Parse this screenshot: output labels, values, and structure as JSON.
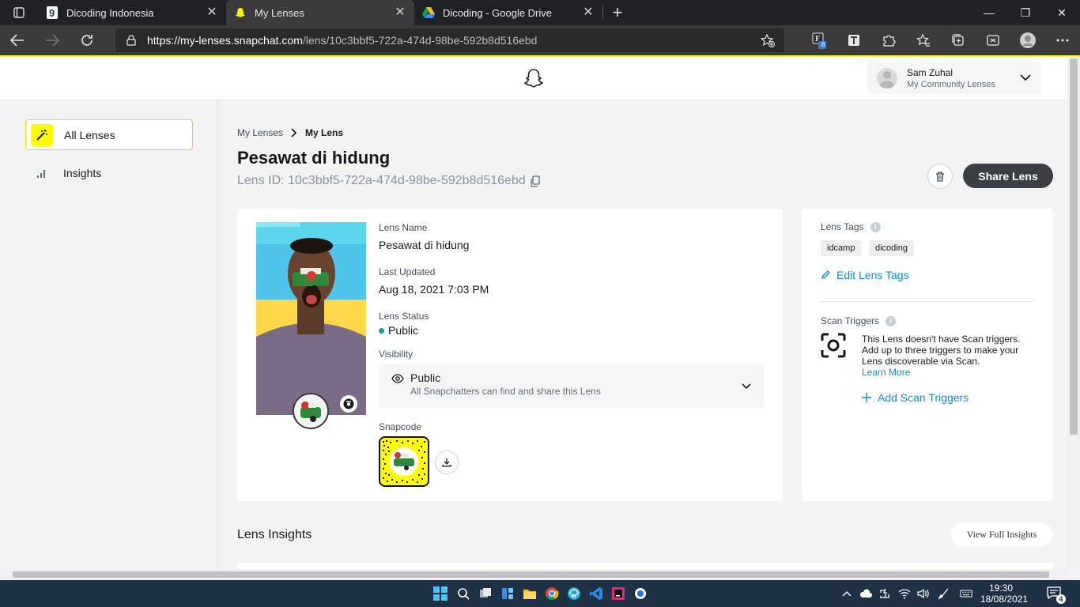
{
  "browser": {
    "tabs": [
      {
        "title": "Dicoding Indonesia",
        "favicon": "dicoding-icon",
        "active": false
      },
      {
        "title": "My Lenses",
        "favicon": "snapchat-icon",
        "active": true
      },
      {
        "title": "Dicoding - Google Drive",
        "favicon": "google-drive-icon",
        "active": false
      }
    ],
    "url_host": "https://my-lenses.snapchat.com",
    "url_path": "/lens/10c3bbf5-722a-474d-98be-592b8d516ebd",
    "extension_badge": "8"
  },
  "header": {
    "logo": "snapchat-ghost-icon",
    "user_name": "Sam Zuhal",
    "user_sub": "My Community Lenses"
  },
  "sidebar": {
    "items": [
      {
        "label": "All Lenses",
        "icon": "magic-wand-icon",
        "active": true
      },
      {
        "label": "Insights",
        "icon": "bar-chart-icon",
        "active": false
      }
    ]
  },
  "breadcrumb": {
    "parent": "My Lenses",
    "current": "My Lens"
  },
  "lens": {
    "title": "Pesawat di hidung",
    "id_text": "Lens ID: 10c3bbf5-722a-474d-98be-592b8d516ebd",
    "share_label": "Share Lens",
    "name_label": "Lens Name",
    "name_value": "Pesawat di hidung",
    "updated_label": "Last Updated",
    "updated_value": "Aug 18, 2021 7:03 PM",
    "status_label": "Lens Status",
    "status_value": "Public",
    "visibility_label": "Visibility",
    "visibility_value": "Public",
    "visibility_desc": "All Snapchatters can find and share this Lens",
    "snapcode_label": "Snapcode"
  },
  "tags": {
    "label": "Lens Tags",
    "items": [
      "idcamp",
      "dicoding"
    ],
    "edit_label": "Edit Lens Tags"
  },
  "scan": {
    "label": "Scan Triggers",
    "text": "This Lens doesn't have Scan triggers. Add up to three triggers to make your Lens discoverable via Scan.",
    "learn_more": "Learn More",
    "add_label": "Add Scan Triggers"
  },
  "insights": {
    "title": "Lens Insights",
    "view_full": "View Full Insights"
  },
  "taskbar": {
    "time": "19:30",
    "date": "18/08/2021",
    "notifications": "4"
  },
  "colors": {
    "snap_yellow": "#fffc00",
    "link_blue": "#0a8ce6",
    "status_green": "#14a38b",
    "dark_button": "#3b3f44"
  }
}
